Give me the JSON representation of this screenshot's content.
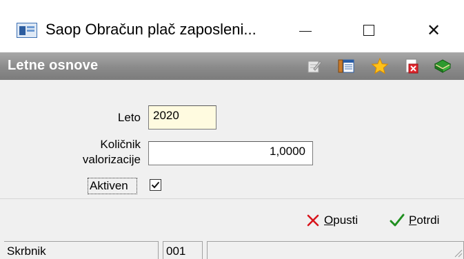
{
  "window": {
    "title": "Saop Obračun plač zaposleni...",
    "minimize_icon": "minimize-icon",
    "maximize_icon": "maximize-icon",
    "close_icon": "close-icon"
  },
  "header": {
    "title": "Letne osnove",
    "tools": [
      "edit-icon",
      "columns-icon",
      "favorite-star-icon",
      "delete-record-icon",
      "help-book-icon"
    ]
  },
  "form": {
    "leto_label": "Leto",
    "leto_value": "2020",
    "kolicnik_label_line1": "Količnik",
    "kolicnik_label_line2": "valorizacije",
    "kolicnik_value": "1,0000",
    "aktiven_label": "Aktiven",
    "aktiven_checked": true
  },
  "actions": {
    "cancel_label": "Opusti",
    "cancel_mnemonic": "O",
    "cancel_rest": "pusti",
    "confirm_label": "Potrdi",
    "confirm_mnemonic": "P",
    "confirm_rest": "otrdi"
  },
  "status": {
    "user": "Skrbnik",
    "code": "001",
    "message": ""
  },
  "colors": {
    "header_bg": "#8a8a8a",
    "highlight_field": "#fffbe0",
    "cancel_red": "#d8141b",
    "confirm_green": "#1f8f1f"
  }
}
